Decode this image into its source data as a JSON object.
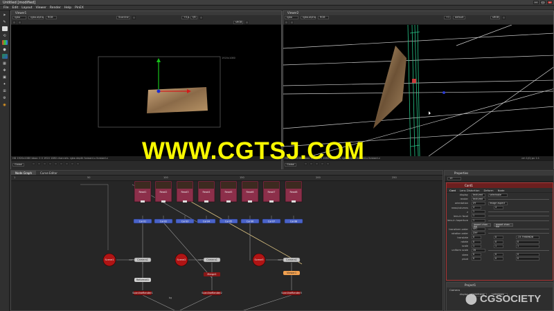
{
  "window": {
    "title": "Untitled [modified]",
    "controls": [
      "–",
      "□",
      "×"
    ]
  },
  "menu": [
    "File",
    "Edit",
    "Layout",
    "Viewer",
    "Render",
    "Help",
    "PinEX"
  ],
  "toolbar_icons": [
    "pointer-icon",
    "brush-icon",
    "eraser-icon",
    "transform-icon",
    "color-icon",
    "circle-icon",
    "gradient-icon",
    "grid-icon",
    "move-icon",
    "camera-icon",
    "light-icon",
    "node-icon",
    "settings-icon",
    "render-icon"
  ],
  "viewer1": {
    "title": "Viewer1",
    "channel": "rgba",
    "alpha": "rgba.alpha",
    "colorspace": "RGB",
    "zoom": "Scanline",
    "gain": "+0.4",
    "fstop": "f/8",
    "gamma": "sRGB",
    "frame_size": "1920x1080",
    "status": "HD 1920x1080 bbox: 0 0 1920 1080 channels: rgba depth forward.u forward.v",
    "frame_label": "1",
    "global_label": "Global"
  },
  "viewer2": {
    "title": "Viewer2",
    "channel": "rgba",
    "alpha": "rgba.alpha",
    "colorspace": "RGB",
    "mode": "default",
    "gain": "+1",
    "gamma": "sRGB",
    "status": "HD 1920x1080 bbox: 0 0 1920 1080 channels: rgba depth forward.u forward.v",
    "right_status": "cm 1(0) px 1:1",
    "frame_label": "1",
    "global_label": "Global"
  },
  "nodegraph": {
    "tabs": [
      "Node Graph",
      "Curve Editor"
    ],
    "ruler_ticks": [
      "1",
      "50",
      "100",
      "150",
      "200",
      "250"
    ],
    "read_nodes": [
      "Read1",
      "Read2",
      "Read3",
      "Read4",
      "Read5",
      "Read6",
      "Read7",
      "Read8"
    ],
    "card_nodes": [
      "Card1",
      "Card2",
      "Card3",
      "Card4",
      "Card5",
      "Card6",
      "Card7",
      "Card8"
    ],
    "scene_nodes": [
      "Scene1",
      "Scene2",
      "Scene3"
    ],
    "camera_nodes": [
      "Camera1"
    ],
    "render_nodes": [
      "ScanlineRender1",
      "ScanlineRender2",
      "ScanlineRender3"
    ],
    "misc_nodes": [
      "Reformat1",
      "Merge1",
      "Merge2",
      "Viewer1"
    ],
    "edge_labels": [
      "cam",
      "cam",
      "cam",
      "bg"
    ]
  },
  "properties": {
    "header": "Properties",
    "count": "10",
    "node_name": "Card1",
    "tabs": [
      "Card",
      "Lens Distortion",
      "Deform",
      "Node"
    ],
    "rows": [
      {
        "label": "display",
        "value": "textured",
        "extra": "selectable"
      },
      {
        "label": "render",
        "value": "textured"
      },
      {
        "label": "orientation",
        "value": "XY",
        "extra": "image aspect"
      },
      {
        "label": "rows/columns",
        "value": "4",
        "value2": "4"
      },
      {
        "label": "z",
        "value": "1"
      },
      {
        "label": "lens-in focal",
        "value": "1"
      },
      {
        "label": "lens-in haperture",
        "value": "1"
      },
      {
        "label": "",
        "value": "import chan file",
        "extra": "export chan file"
      },
      {
        "label": "transform order",
        "value": "SRT"
      },
      {
        "label": "rotation order",
        "value": "ZXY"
      },
      {
        "label": "translate",
        "value": "0",
        "value2": "0",
        "value3": "-23.79889626"
      },
      {
        "label": "rotate",
        "value": "0",
        "value2": "0",
        "value3": "0"
      },
      {
        "label": "scale",
        "value": "1",
        "value2": "1",
        "value3": "1"
      },
      {
        "label": "uniform scale",
        "value": "20"
      },
      {
        "label": "skew",
        "value": "0",
        "value2": "0",
        "value3": "0"
      },
      {
        "label": "pivot",
        "value": "0",
        "value2": "0",
        "value3": "0"
      }
    ],
    "panel2_name": "Project1",
    "panel2_sub": "Camera",
    "panel2_display": "wireframe",
    "panel2_selectable": "selectable"
  },
  "watermark": "WWW.CGTSJ.COM",
  "logo": "CGSOCIETY",
  "colors": {
    "read_node": "#8c2f4a",
    "card_node": "#4a63c8",
    "scene_node": "#b01414",
    "render_node": "#8a1717",
    "camera_node": "#c8c8c8",
    "viewer_node": "#f0a050",
    "watermark": "#f7f700"
  }
}
